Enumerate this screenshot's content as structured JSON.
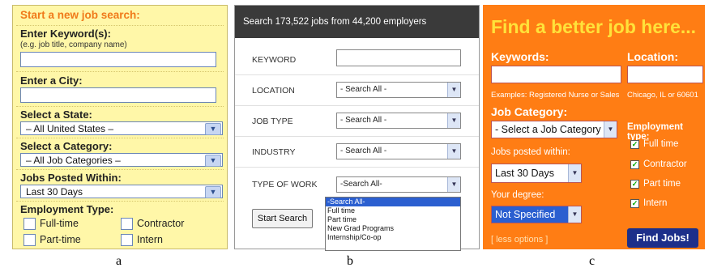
{
  "panel_a": {
    "title": "Start a new job search:",
    "keyword_label": "Enter Keyword(s):",
    "keyword_hint": "(e.g. job title, company name)",
    "city_label": "Enter a City:",
    "state_label": "Select a State:",
    "state_value": "– All United States –",
    "category_label": "Select a Category:",
    "category_value": "– All Job Categories –",
    "posted_label": "Jobs Posted Within:",
    "posted_value": "Last 30 Days",
    "employment_label": "Employment Type:",
    "types": [
      "Full-time",
      "Contractor",
      "Part-time",
      "Intern"
    ],
    "caption": "a"
  },
  "panel_b": {
    "header": "Search 173,522 jobs from 44,200 employers",
    "keyword_label": "KEYWORD",
    "location_label": "LOCATION",
    "location_value": "- Search All -",
    "jobtype_label": "JOB TYPE",
    "jobtype_value": "- Search All -",
    "industry_label": "INDUSTRY",
    "industry_value": "- Search All -",
    "work_label": "TYPE OF WORK",
    "work_value": "-Search All-",
    "work_options": [
      "-Search All-",
      "Full time",
      "Part time",
      "New Grad Programs",
      "Internship/Co-op"
    ],
    "search_button": "Start Search",
    "caption": "b"
  },
  "panel_c": {
    "title": "Find a better job here...",
    "keywords_label": "Keywords:",
    "location_label": "Location:",
    "keywords_hint": "Examples: Registered Nurse or Sales",
    "location_hint": "Chicago, IL or 60601",
    "category_label": "Job Category:",
    "category_value": "- Select a Job Category -",
    "posted_label": "Jobs posted within:",
    "posted_value": "Last 30 Days",
    "degree_label": "Your degree:",
    "degree_value": "Not Specified",
    "employment_label": "Employment type:",
    "types": [
      "Full time",
      "Contractor",
      "Part time",
      "Intern"
    ],
    "less_options": "[ less options ]",
    "find_button": "Find Jobs!",
    "caption": "c"
  }
}
